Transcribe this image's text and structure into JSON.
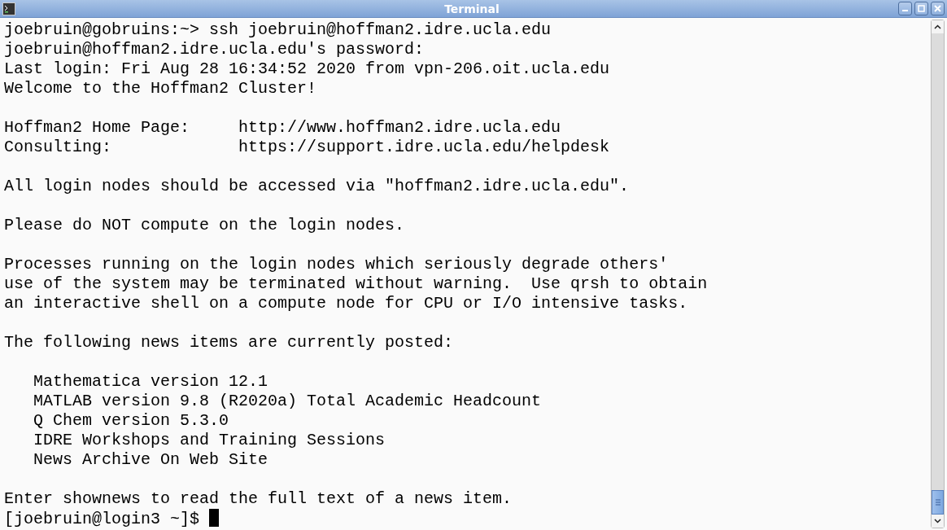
{
  "window": {
    "title": "Terminal"
  },
  "terminal": {
    "blocks": [
      [
        "joebruin@gobruins:~> ssh joebruin@hoffman2.idre.ucla.edu",
        "joebruin@hoffman2.idre.ucla.edu's password:",
        "Last login: Fri Aug 28 16:34:52 2020 from vpn-206.oit.ucla.edu",
        "Welcome to the Hoffman2 Cluster!"
      ],
      [
        "Hoffman2 Home Page:     http://www.hoffman2.idre.ucla.edu",
        "Consulting:             https://support.idre.ucla.edu/helpdesk"
      ],
      [
        "All login nodes should be accessed via \"hoffman2.idre.ucla.edu\"."
      ],
      [
        "Please do NOT compute on the login nodes."
      ],
      [
        "Processes running on the login nodes which seriously degrade others'",
        "use of the system may be terminated without warning.  Use qrsh to obtain",
        "an interactive shell on a compute node for CPU or I/O intensive tasks."
      ],
      [
        "The following news items are currently posted:"
      ],
      [
        "   Mathematica version 12.1",
        "   MATLAB version 9.8 (R2020a) Total Academic Headcount",
        "   Q Chem version 5.3.0",
        "   IDRE Workshops and Training Sessions",
        "   News Archive On Web Site"
      ],
      [
        "Enter shownews to read the full text of a news item."
      ]
    ],
    "prompt": {
      "text": "[joebruin@login3 ~]$ ",
      "cursor": true
    }
  }
}
